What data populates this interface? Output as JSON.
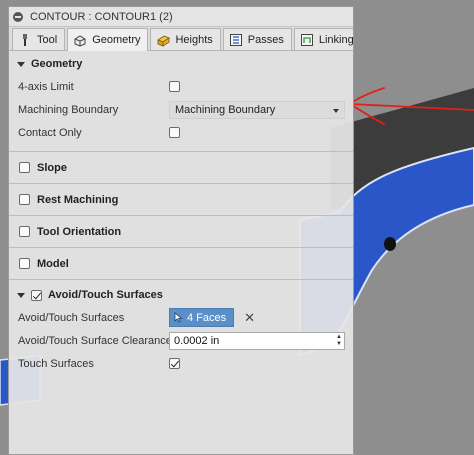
{
  "window": {
    "title": "CONTOUR : CONTOUR1 (2)"
  },
  "tabs": [
    {
      "label": "Tool",
      "icon": "tool-icon",
      "active": false
    },
    {
      "label": "Geometry",
      "icon": "geometry-icon",
      "active": true
    },
    {
      "label": "Heights",
      "icon": "heights-icon",
      "active": false
    },
    {
      "label": "Passes",
      "icon": "passes-icon",
      "active": false
    },
    {
      "label": "Linking",
      "icon": "linking-icon",
      "active": false
    }
  ],
  "geometry": {
    "header": "Geometry",
    "four_axis_label": "4-axis Limit",
    "four_axis_checked": false,
    "boundary_label": "Machining Boundary",
    "boundary_value": "Machining Boundary",
    "contact_only_label": "Contact Only",
    "contact_only_checked": false
  },
  "sections": {
    "slope": "Slope",
    "rest": "Rest Machining",
    "tool_orientation": "Tool Orientation",
    "model": "Model"
  },
  "avoid": {
    "header": "Avoid/Touch Surfaces",
    "enabled": true,
    "surfaces_label": "Avoid/Touch Surfaces",
    "faces_button": "4 Faces",
    "clearance_label": "Avoid/Touch Surface Clearance",
    "clearance_value": "0.0002 in",
    "touch_label": "Touch Surfaces",
    "touch_checked": true
  },
  "colors": {
    "part_blue": "#2a56c8",
    "annotation_red": "#e0201a",
    "selection_blue": "#5b8fc7"
  }
}
